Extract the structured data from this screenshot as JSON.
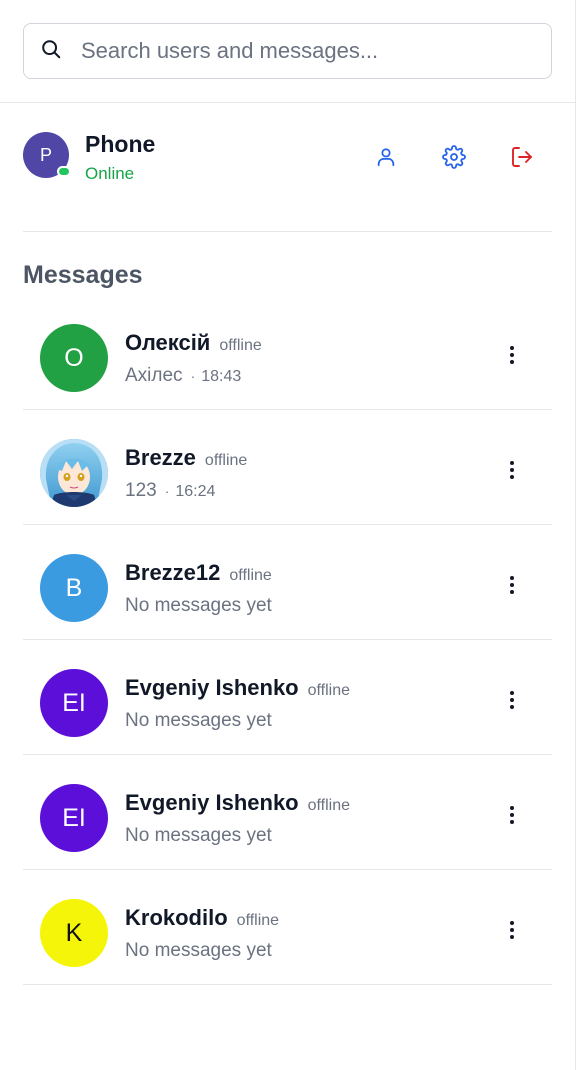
{
  "search": {
    "placeholder": "Search users and messages..."
  },
  "profile": {
    "initial": "P",
    "name": "Phone",
    "status": "Online",
    "avatar_color": "#4f46a5"
  },
  "section_title": "Messages",
  "conversations": [
    {
      "initials": "O",
      "name": "Олексій",
      "status": "offline",
      "preview": "Ахілес",
      "time": "18:43",
      "avatar_color": "#22a044",
      "initials_color": "#ffffff"
    },
    {
      "initials": "",
      "name": "Brezze",
      "status": "offline",
      "preview": "123",
      "time": "16:24",
      "avatar_color": "#5aa8d8",
      "initials_color": "#ffffff"
    },
    {
      "initials": "B",
      "name": "Brezze12",
      "status": "offline",
      "preview": "No messages yet",
      "time": "",
      "avatar_color": "#3b9be0",
      "initials_color": "#ffffff"
    },
    {
      "initials": "EI",
      "name": "Evgeniy Ishenko",
      "status": "offline",
      "preview": "No messages yet",
      "time": "",
      "avatar_color": "#5b0fd9",
      "initials_color": "#ffffff"
    },
    {
      "initials": "EI",
      "name": "Evgeniy Ishenko",
      "status": "offline",
      "preview": "No messages yet",
      "time": "",
      "avatar_color": "#5b0fd9",
      "initials_color": "#ffffff"
    },
    {
      "initials": "K",
      "name": "Krokodilo",
      "status": "offline",
      "preview": "No messages yet",
      "time": "",
      "avatar_color": "#f5f50a",
      "initials_color": "#111111"
    }
  ],
  "colors": {
    "accent_blue": "#2563eb",
    "logout_red": "#dc2626",
    "online_green": "#16a34a"
  },
  "icons": {
    "search": "search-icon",
    "profile": "user-icon",
    "settings": "gear-icon",
    "logout": "logout-icon",
    "more": "more-vertical-icon"
  }
}
